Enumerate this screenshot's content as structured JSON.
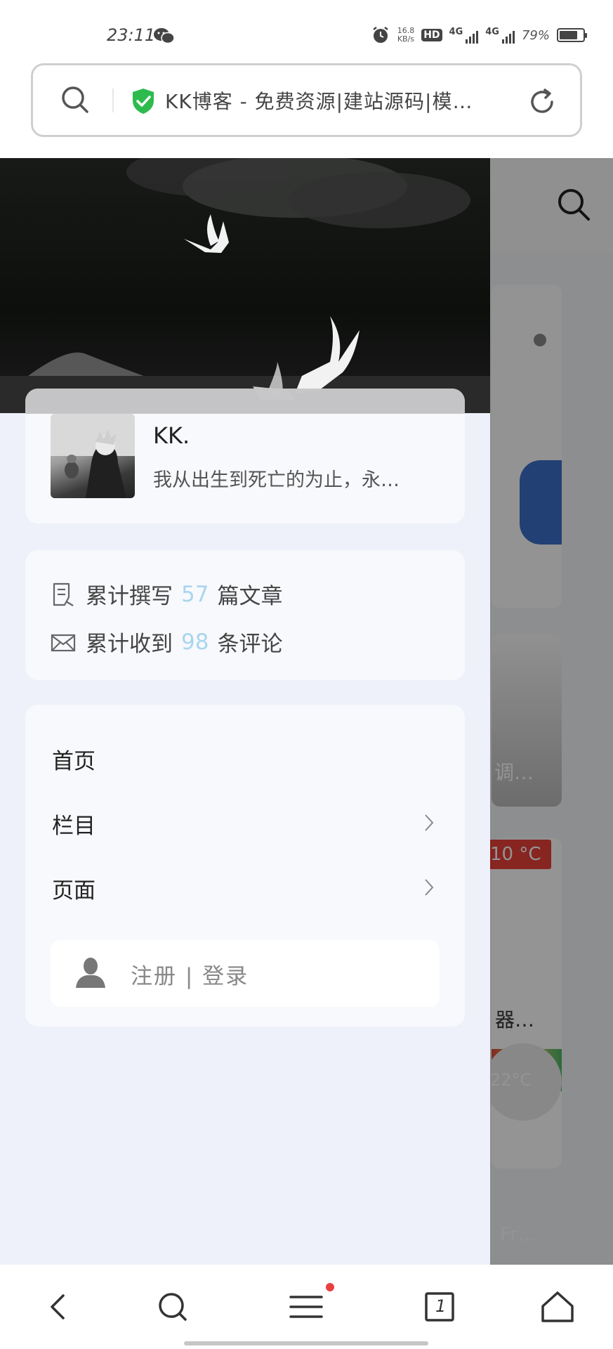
{
  "status_bar": {
    "time": "23:11",
    "net_speed_value": "16.8",
    "net_speed_unit": "KB/s",
    "hd_label": "HD",
    "signal_1": "4G",
    "signal_2": "4G",
    "battery_percent": "79%",
    "battery_level": 0.79
  },
  "address_bar": {
    "title": "KK博客 - 免费资源|建站源码|模…",
    "secure": true
  },
  "background_page": {
    "snippet_1": "调…",
    "temperature": "10 °C",
    "snippet_2": "器…",
    "snippet_3": "Fr…",
    "temp_badge_2": "22°C"
  },
  "drawer": {
    "profile": {
      "name": "KK.",
      "bio": "我从出生到死亡的为止，永…"
    },
    "stats": {
      "posts_prefix": "累计撰写",
      "posts_count": "57",
      "posts_suffix": "篇文章",
      "comments_prefix": "累计收到",
      "comments_count": "98",
      "comments_suffix": "条评论"
    },
    "menu": [
      {
        "label": "首页",
        "has_submenu": false
      },
      {
        "label": "栏目",
        "has_submenu": true
      },
      {
        "label": "页面",
        "has_submenu": true
      }
    ],
    "login_label": "注册 | 登录"
  },
  "colors": {
    "accent_number": "#a9d6ec",
    "shield_green": "#2dbb4e",
    "notification_dot": "#e84040",
    "temp_red": "#e8413a"
  },
  "bottom_nav": {
    "tab_count": "1",
    "icons": [
      "back-icon",
      "search-icon",
      "menu-icon",
      "tabs-icon",
      "home-icon"
    ]
  }
}
